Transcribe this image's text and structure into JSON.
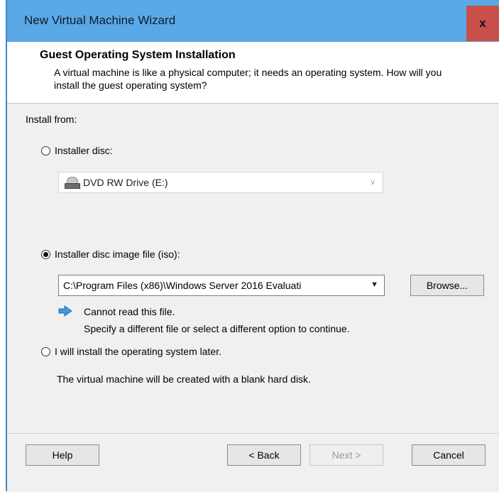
{
  "window": {
    "title": "New Virtual Machine Wizard",
    "close_label": "x"
  },
  "header": {
    "title": "Guest Operating System Installation",
    "description": "A virtual machine is like a physical computer; it needs an operating system. How will you install the guest operating system?"
  },
  "install_from_label": "Install from:",
  "options": {
    "installer_disc": {
      "label": "Installer disc:",
      "selected": false,
      "drive_value": "DVD RW Drive (E:)"
    },
    "iso": {
      "label": "Installer disc image file (iso):",
      "selected": true,
      "path_value": "C:\\Program Files (x86)\\Windows Server 2016 Evaluati",
      "browse_label": "Browse...",
      "warning_line1": "Cannot read this file.",
      "warning_line2": "Specify a different file or select a different option to continue."
    },
    "later": {
      "label": "I will install the operating system later.",
      "selected": false,
      "description": "The virtual machine will be created with a blank hard disk."
    }
  },
  "footer": {
    "help": "Help",
    "back": "< Back",
    "next": "Next >",
    "cancel": "Cancel"
  },
  "icons": {
    "drive": "dvd-drive-icon",
    "warning": "info-arrow-icon"
  },
  "colors": {
    "titlebar": "#5aa8e5",
    "close": "#c9504a",
    "window_bg": "#f0f0f0",
    "arrow_icon": "#3a9be0"
  }
}
